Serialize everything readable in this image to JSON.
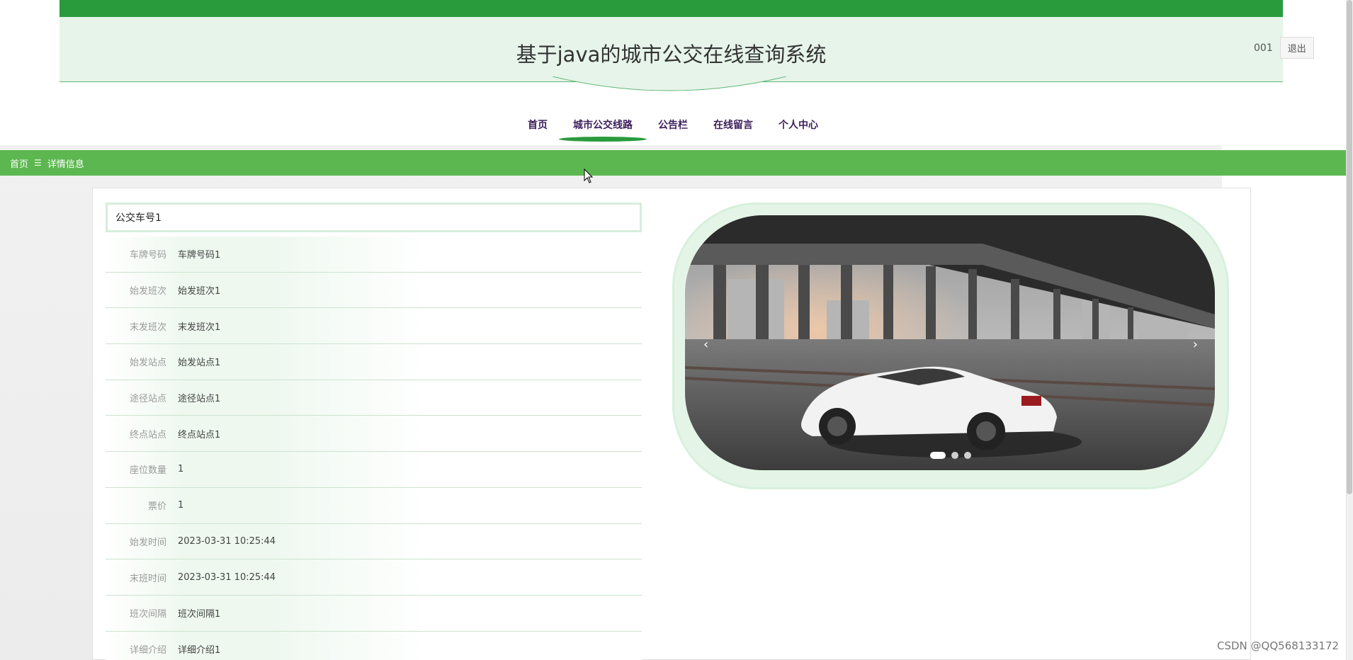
{
  "header": {
    "title": "基于java的城市公交在线查询系统",
    "user": "001",
    "logout_label": "退出"
  },
  "nav": {
    "items": [
      "首页",
      "城市公交线路",
      "公告栏",
      "在线留言",
      "个人中心"
    ],
    "active_index": 1
  },
  "breadcrumb": {
    "home": "首页",
    "separator": "☰",
    "current": "详情信息"
  },
  "detail": {
    "title": "公交车号1",
    "rows": [
      {
        "label": "车牌号码",
        "value": "车牌号码1"
      },
      {
        "label": "始发班次",
        "value": "始发班次1"
      },
      {
        "label": "末发班次",
        "value": "末发班次1"
      },
      {
        "label": "始发站点",
        "value": "始发站点1"
      },
      {
        "label": "途径站点",
        "value": "途径站点1"
      },
      {
        "label": "终点站点",
        "value": "终点站点1"
      },
      {
        "label": "座位数量",
        "value": "1"
      },
      {
        "label": "票价",
        "value": "1"
      },
      {
        "label": "始发时间",
        "value": "2023-03-31 10:25:44"
      },
      {
        "label": "末班时间",
        "value": "2023-03-31 10:25:44"
      },
      {
        "label": "班次间隔",
        "value": "班次间隔1"
      },
      {
        "label": "详细介绍",
        "value": "详细介绍1"
      }
    ]
  },
  "carousel": {
    "prev_icon": "‹",
    "next_icon": "›",
    "slide_count": 3,
    "active_slide": 0
  },
  "watermark": "CSDN @QQ568133172",
  "colors": {
    "primary_green": "#2a9b3d",
    "breadcrumb_green": "#5db750",
    "header_bg": "#e6f4ea"
  }
}
